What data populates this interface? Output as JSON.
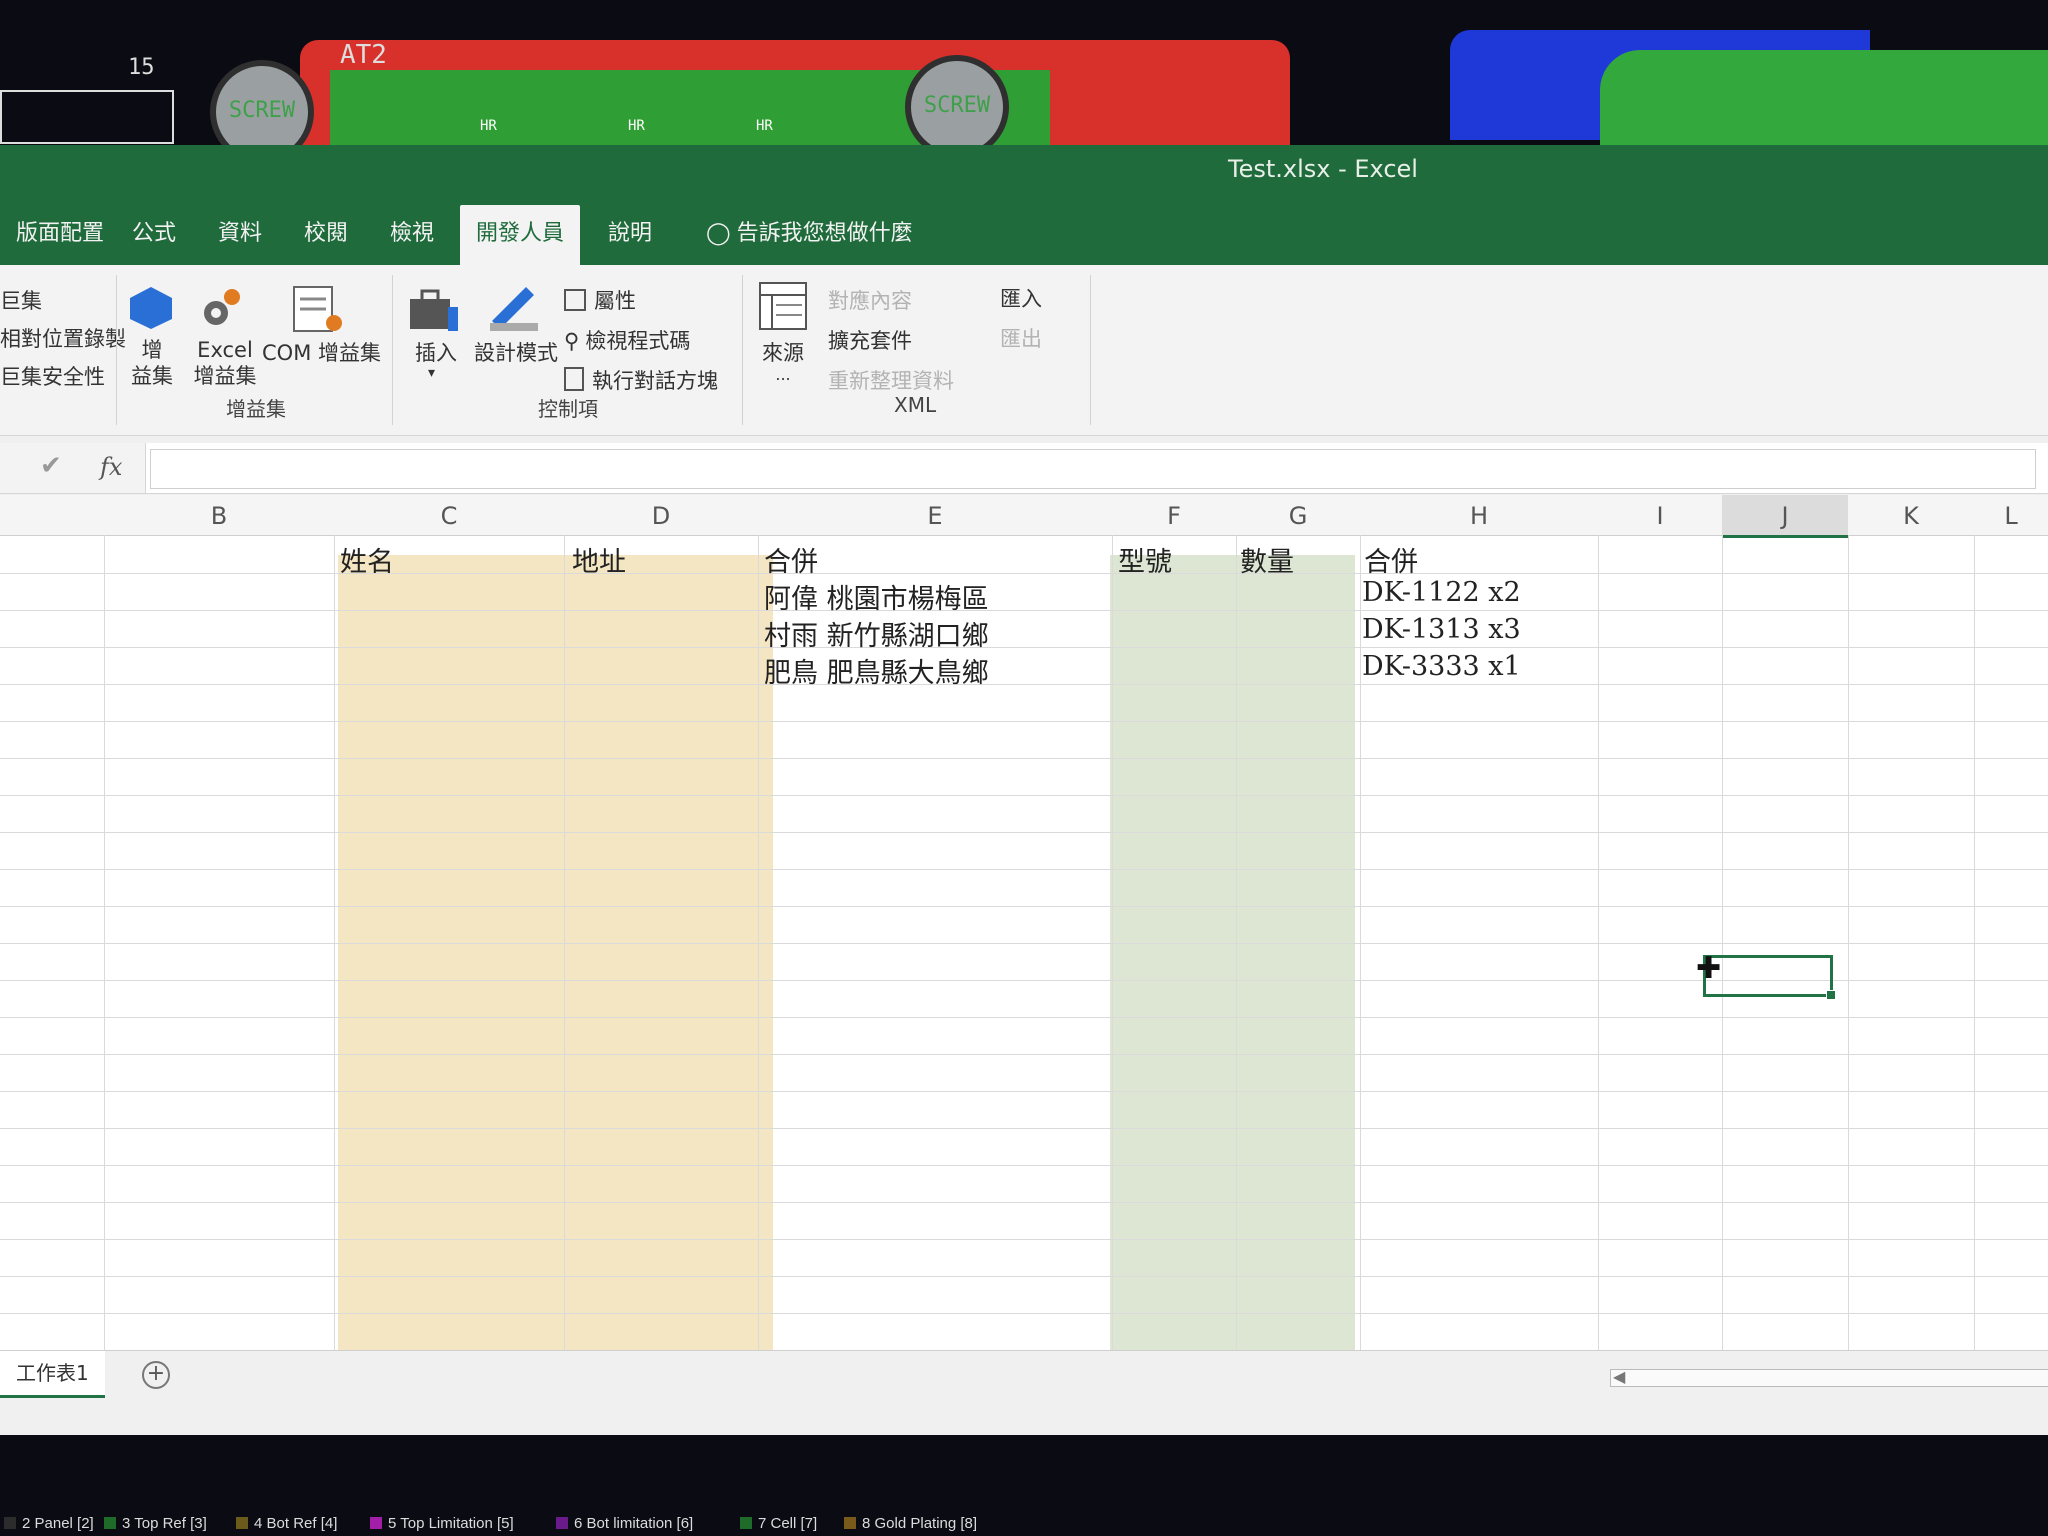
{
  "pcb": {
    "labels": [
      "15",
      "AT2"
    ],
    "screw_label": "SCREW",
    "pad_labels": [
      "HR",
      "HR",
      "HR"
    ],
    "bottom_layers": [
      {
        "label": "2 Panel [2]",
        "color": "#2c2c2c"
      },
      {
        "label": "3 Top Ref [3]",
        "color": "#1f6b2a"
      },
      {
        "label": "4 Bot Ref [4]",
        "color": "#6b5a1a"
      },
      {
        "label": "5 Top Limitation [5]",
        "color": "#a31fa8"
      },
      {
        "label": "6 Bot limitation [6]",
        "color": "#6a1b8a"
      },
      {
        "label": "7 Cell [7]",
        "color": "#1f6b2a"
      },
      {
        "label": "8 Gold Plating [8]",
        "color": "#7a5a1a"
      }
    ]
  },
  "window": {
    "title": "Test.xlsx  -  Excel"
  },
  "ribbon_tabs": [
    {
      "label": "版面配置",
      "active": false
    },
    {
      "label": "公式",
      "active": false
    },
    {
      "label": "資料",
      "active": false
    },
    {
      "label": "校閱",
      "active": false
    },
    {
      "label": "檢視",
      "active": false
    },
    {
      "label": "開發人員",
      "active": true
    },
    {
      "label": "說明",
      "active": false
    },
    {
      "label": "告訴我您想做什麼",
      "active": false
    }
  ],
  "ribbon": {
    "left_partial": [
      "巨集",
      "相對位置錄製",
      "巨集安全性"
    ],
    "addins": {
      "btn1": "增\n益集",
      "btn2": "Excel\n增益集",
      "btn3": "COM 增益集",
      "group": "增益集"
    },
    "controls": {
      "insert": "插入",
      "design": "設計模式",
      "properties": "屬性",
      "view_code": "檢視程式碼",
      "run_dialog": "執行對話方塊",
      "group": "控制項"
    },
    "xml": {
      "source": "來源",
      "source_more": "...",
      "map_props": "對應內容",
      "expansion": "擴充套件",
      "refresh": "重新整理資料",
      "import": "匯入",
      "export": "匯出",
      "group": "XML"
    }
  },
  "formula_bar": {
    "check": "✔",
    "fx": "fx",
    "value": ""
  },
  "columns": [
    "B",
    "C",
    "D",
    "E",
    "F",
    "G",
    "H",
    "I",
    "J",
    "K",
    "L"
  ],
  "selected_column": "J",
  "cells": {
    "C1": "姓名",
    "D1": "地址",
    "E1": "合併",
    "E2": "阿偉 桃園市楊梅區",
    "E3": "村雨 新竹縣湖口鄉",
    "E4": "肥鳥 肥鳥縣大鳥鄉",
    "F1": "型號",
    "G1": "數量",
    "H1": "合併",
    "H2": "DK-1122 x2",
    "H3": "DK-1313 x3",
    "H4": "DK-3333 x1"
  },
  "sheet": {
    "tab": "工作表1",
    "add": "+"
  }
}
